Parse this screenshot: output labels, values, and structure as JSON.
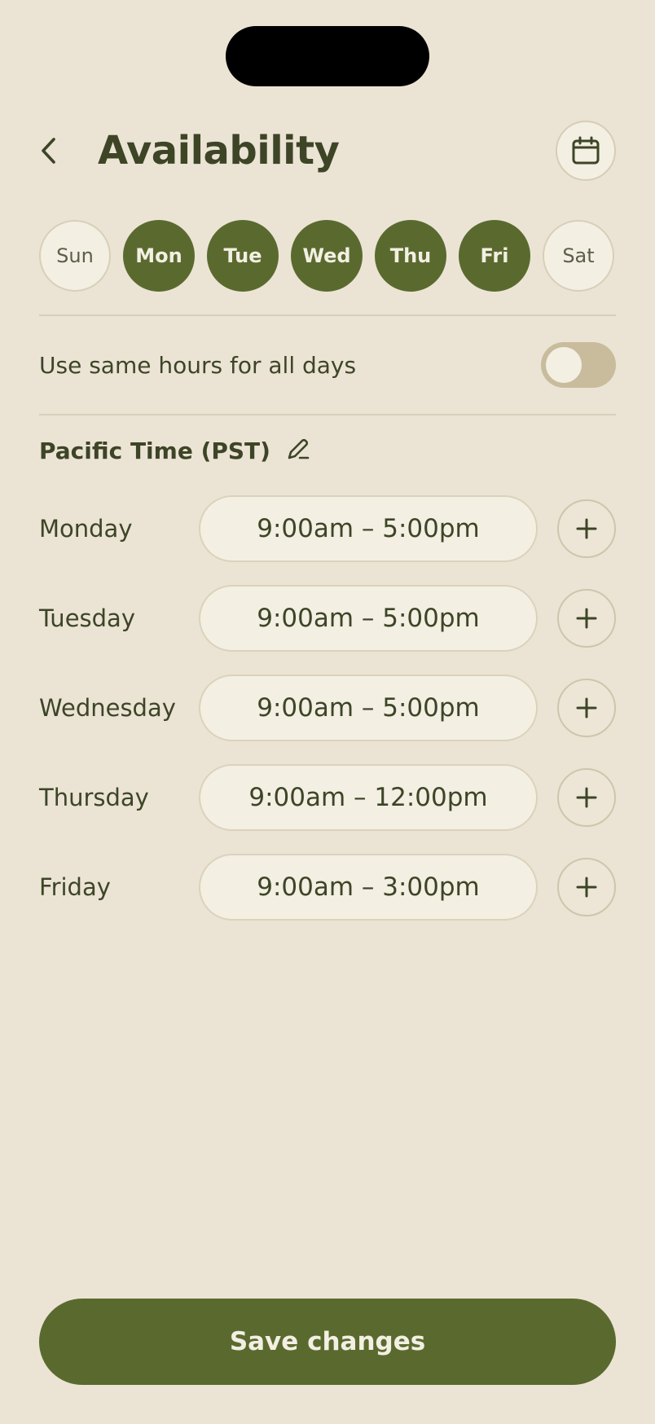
{
  "header": {
    "title": "Availability"
  },
  "weekdays": [
    {
      "label": "Sun",
      "active": false
    },
    {
      "label": "Mon",
      "active": true
    },
    {
      "label": "Tue",
      "active": true
    },
    {
      "label": "Wed",
      "active": true
    },
    {
      "label": "Thu",
      "active": true
    },
    {
      "label": "Fri",
      "active": true
    },
    {
      "label": "Sat",
      "active": false
    }
  ],
  "same_hours": {
    "label": "Use same hours for all days",
    "enabled": false
  },
  "timezone": {
    "label": "Pacific Time (PST)"
  },
  "schedule": [
    {
      "day": "Monday",
      "hours": "9:00am – 5:00pm"
    },
    {
      "day": "Tuesday",
      "hours": "9:00am – 5:00pm"
    },
    {
      "day": "Wednesday",
      "hours": "9:00am – 5:00pm"
    },
    {
      "day": "Thursday",
      "hours": "9:00am – 12:00pm"
    },
    {
      "day": "Friday",
      "hours": "9:00am – 3:00pm"
    }
  ],
  "save_label": "Save changes",
  "colors": {
    "accent": "#5a6a2f",
    "background": "#ebe4d5",
    "surface": "#f3efe3",
    "text": "#3d4526"
  }
}
